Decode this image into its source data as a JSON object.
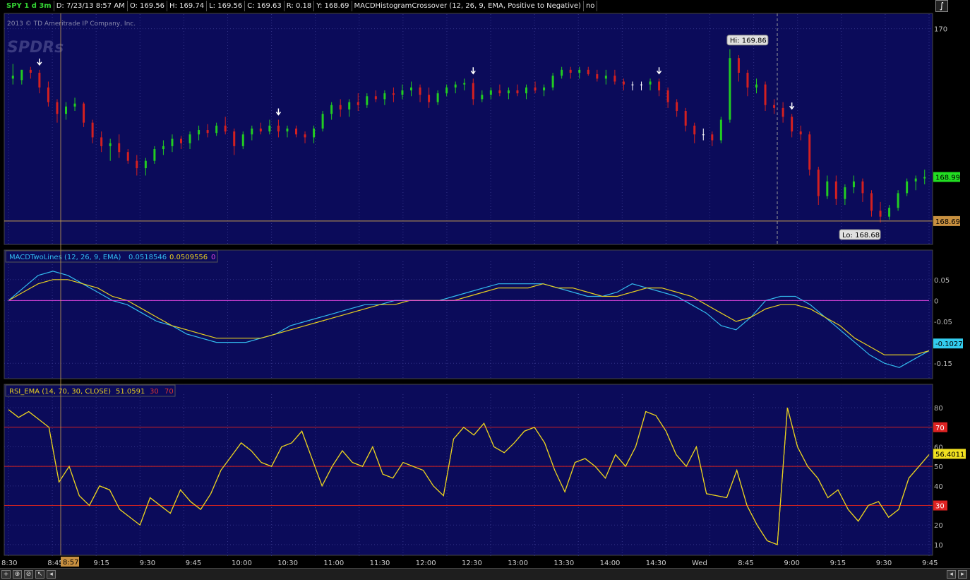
{
  "header": {
    "symbol": "SPY 1 d 3m",
    "date": "D: 7/23/13 8:57 AM",
    "open": "O: 169.56",
    "high": "H: 169.74",
    "low": "L: 169.56",
    "close": "C: 169.63",
    "range": "R: 0.18",
    "y": "Y: 168.69",
    "study": "MACDHistogramCrossover (12, 26, 9, EMA, Positive to Negative)",
    "study_value": "no"
  },
  "copyright": "2013 © TD Ameritrade IP Company, Inc.",
  "watermark": "SPDRs",
  "colors": {
    "background": "#0b0b5a",
    "up": "#22cc22",
    "down": "#d42020",
    "doji": "#ffffff",
    "macd": "#33bbee",
    "signal": "#e8d020",
    "zero": "#dd44dd",
    "rsi": "#e8d020",
    "rsi_lines": "#cc2222",
    "crosshair": "#c8a050"
  },
  "chart_data": [
    {
      "type": "candlestick",
      "title": "SPY 1 d 3m",
      "ylim": [
        168.55,
        170.08
      ],
      "y_ticks": [
        170
      ],
      "current_price": "168.99",
      "crosshair_price": "168.69",
      "hi_label": "Hi: 169.86",
      "lo_label": "Lo: 168.68",
      "sell_arrows_at_bar": [
        3,
        30,
        52,
        73,
        88
      ],
      "candles": [
        {
          "o": 169.66,
          "h": 169.76,
          "l": 169.62,
          "c": 169.68
        },
        {
          "o": 169.65,
          "h": 169.72,
          "l": 169.62,
          "c": 169.72
        },
        {
          "o": 169.72,
          "h": 169.74,
          "l": 169.66,
          "c": 169.7
        },
        {
          "o": 169.7,
          "h": 169.72,
          "l": 169.56,
          "c": 169.6
        },
        {
          "o": 169.6,
          "h": 169.64,
          "l": 169.47,
          "c": 169.5
        },
        {
          "o": 169.5,
          "h": 169.52,
          "l": 169.36,
          "c": 169.42
        },
        {
          "o": 169.42,
          "h": 169.5,
          "l": 169.38,
          "c": 169.47
        },
        {
          "o": 169.47,
          "h": 169.53,
          "l": 169.44,
          "c": 169.49
        },
        {
          "o": 169.49,
          "h": 169.5,
          "l": 169.33,
          "c": 169.36
        },
        {
          "o": 169.36,
          "h": 169.38,
          "l": 169.22,
          "c": 169.26
        },
        {
          "o": 169.26,
          "h": 169.3,
          "l": 169.16,
          "c": 169.2
        },
        {
          "o": 169.2,
          "h": 169.25,
          "l": 169.1,
          "c": 169.22
        },
        {
          "o": 169.22,
          "h": 169.28,
          "l": 169.12,
          "c": 169.16
        },
        {
          "o": 169.16,
          "h": 169.18,
          "l": 169.08,
          "c": 169.1
        },
        {
          "o": 169.1,
          "h": 169.14,
          "l": 169.0,
          "c": 169.05
        },
        {
          "o": 169.05,
          "h": 169.12,
          "l": 169.0,
          "c": 169.1
        },
        {
          "o": 169.1,
          "h": 169.2,
          "l": 169.08,
          "c": 169.18
        },
        {
          "o": 169.18,
          "h": 169.24,
          "l": 169.14,
          "c": 169.2
        },
        {
          "o": 169.2,
          "h": 169.28,
          "l": 169.16,
          "c": 169.25
        },
        {
          "o": 169.25,
          "h": 169.27,
          "l": 169.18,
          "c": 169.22
        },
        {
          "o": 169.22,
          "h": 169.3,
          "l": 169.18,
          "c": 169.28
        },
        {
          "o": 169.28,
          "h": 169.34,
          "l": 169.24,
          "c": 169.31
        },
        {
          "o": 169.31,
          "h": 169.35,
          "l": 169.26,
          "c": 169.29
        },
        {
          "o": 169.29,
          "h": 169.36,
          "l": 169.27,
          "c": 169.34
        },
        {
          "o": 169.34,
          "h": 169.4,
          "l": 169.28,
          "c": 169.3
        },
        {
          "o": 169.3,
          "h": 169.32,
          "l": 169.14,
          "c": 169.2
        },
        {
          "o": 169.2,
          "h": 169.3,
          "l": 169.18,
          "c": 169.28
        },
        {
          "o": 169.28,
          "h": 169.34,
          "l": 169.24,
          "c": 169.32
        },
        {
          "o": 169.32,
          "h": 169.36,
          "l": 169.28,
          "c": 169.3
        },
        {
          "o": 169.3,
          "h": 169.38,
          "l": 169.28,
          "c": 169.34
        },
        {
          "o": 169.34,
          "h": 169.38,
          "l": 169.26,
          "c": 169.3
        },
        {
          "o": 169.3,
          "h": 169.34,
          "l": 169.26,
          "c": 169.32
        },
        {
          "o": 169.32,
          "h": 169.34,
          "l": 169.26,
          "c": 169.28
        },
        {
          "o": 169.28,
          "h": 169.3,
          "l": 169.22,
          "c": 169.26
        },
        {
          "o": 169.26,
          "h": 169.34,
          "l": 169.22,
          "c": 169.32
        },
        {
          "o": 169.32,
          "h": 169.44,
          "l": 169.3,
          "c": 169.42
        },
        {
          "o": 169.42,
          "h": 169.5,
          "l": 169.38,
          "c": 169.48
        },
        {
          "o": 169.48,
          "h": 169.52,
          "l": 169.4,
          "c": 169.45
        },
        {
          "o": 169.45,
          "h": 169.52,
          "l": 169.4,
          "c": 169.5
        },
        {
          "o": 169.5,
          "h": 169.56,
          "l": 169.44,
          "c": 169.48
        },
        {
          "o": 169.48,
          "h": 169.56,
          "l": 169.46,
          "c": 169.54
        },
        {
          "o": 169.54,
          "h": 169.58,
          "l": 169.5,
          "c": 169.52
        },
        {
          "o": 169.52,
          "h": 169.58,
          "l": 169.48,
          "c": 169.56
        },
        {
          "o": 169.56,
          "h": 169.6,
          "l": 169.5,
          "c": 169.55
        },
        {
          "o": 169.55,
          "h": 169.62,
          "l": 169.52,
          "c": 169.58
        },
        {
          "o": 169.58,
          "h": 169.64,
          "l": 169.54,
          "c": 169.6
        },
        {
          "o": 169.6,
          "h": 169.62,
          "l": 169.5,
          "c": 169.55
        },
        {
          "o": 169.55,
          "h": 169.6,
          "l": 169.46,
          "c": 169.5
        },
        {
          "o": 169.5,
          "h": 169.58,
          "l": 169.48,
          "c": 169.56
        },
        {
          "o": 169.56,
          "h": 169.62,
          "l": 169.54,
          "c": 169.6
        },
        {
          "o": 169.6,
          "h": 169.64,
          "l": 169.56,
          "c": 169.62
        },
        {
          "o": 169.62,
          "h": 169.66,
          "l": 169.58,
          "c": 169.63
        },
        {
          "o": 169.63,
          "h": 169.66,
          "l": 169.48,
          "c": 169.52
        },
        {
          "o": 169.52,
          "h": 169.58,
          "l": 169.5,
          "c": 169.55
        },
        {
          "o": 169.55,
          "h": 169.6,
          "l": 169.52,
          "c": 169.58
        },
        {
          "o": 169.58,
          "h": 169.62,
          "l": 169.54,
          "c": 169.56
        },
        {
          "o": 169.56,
          "h": 169.6,
          "l": 169.52,
          "c": 169.58
        },
        {
          "o": 169.58,
          "h": 169.62,
          "l": 169.54,
          "c": 169.56
        },
        {
          "o": 169.56,
          "h": 169.62,
          "l": 169.52,
          "c": 169.6
        },
        {
          "o": 169.6,
          "h": 169.64,
          "l": 169.56,
          "c": 169.58
        },
        {
          "o": 169.58,
          "h": 169.62,
          "l": 169.54,
          "c": 169.6
        },
        {
          "o": 169.6,
          "h": 169.7,
          "l": 169.58,
          "c": 169.68
        },
        {
          "o": 169.68,
          "h": 169.74,
          "l": 169.66,
          "c": 169.72
        },
        {
          "o": 169.72,
          "h": 169.74,
          "l": 169.66,
          "c": 169.7
        },
        {
          "o": 169.7,
          "h": 169.74,
          "l": 169.66,
          "c": 169.72
        },
        {
          "o": 169.72,
          "h": 169.74,
          "l": 169.68,
          "c": 169.69
        },
        {
          "o": 169.69,
          "h": 169.72,
          "l": 169.64,
          "c": 169.66
        },
        {
          "o": 169.66,
          "h": 169.72,
          "l": 169.62,
          "c": 169.68
        },
        {
          "o": 169.68,
          "h": 169.72,
          "l": 169.62,
          "c": 169.64
        },
        {
          "o": 169.64,
          "h": 169.66,
          "l": 169.58,
          "c": 169.62
        },
        {
          "o": 169.62,
          "h": 169.64,
          "l": 169.58,
          "c": 169.62
        },
        {
          "o": 169.62,
          "h": 169.64,
          "l": 169.58,
          "c": 169.62
        },
        {
          "o": 169.62,
          "h": 169.66,
          "l": 169.58,
          "c": 169.64
        },
        {
          "o": 169.64,
          "h": 169.66,
          "l": 169.54,
          "c": 169.58
        },
        {
          "o": 169.58,
          "h": 169.6,
          "l": 169.46,
          "c": 169.5
        },
        {
          "o": 169.5,
          "h": 169.52,
          "l": 169.4,
          "c": 169.44
        },
        {
          "o": 169.44,
          "h": 169.46,
          "l": 169.3,
          "c": 169.34
        },
        {
          "o": 169.34,
          "h": 169.36,
          "l": 169.22,
          "c": 169.28
        },
        {
          "o": 169.28,
          "h": 169.32,
          "l": 169.24,
          "c": 169.28
        },
        {
          "o": 169.28,
          "h": 169.3,
          "l": 169.2,
          "c": 169.24
        },
        {
          "o": 169.24,
          "h": 169.4,
          "l": 169.22,
          "c": 169.38
        },
        {
          "o": 169.38,
          "h": 169.86,
          "l": 169.36,
          "c": 169.8
        },
        {
          "o": 169.8,
          "h": 169.82,
          "l": 169.64,
          "c": 169.7
        },
        {
          "o": 169.7,
          "h": 169.72,
          "l": 169.54,
          "c": 169.6
        },
        {
          "o": 169.6,
          "h": 169.66,
          "l": 169.56,
          "c": 169.62
        },
        {
          "o": 169.62,
          "h": 169.64,
          "l": 169.44,
          "c": 169.48
        },
        {
          "o": 169.48,
          "h": 169.52,
          "l": 169.42,
          "c": 169.46
        },
        {
          "o": 169.46,
          "h": 169.5,
          "l": 169.36,
          "c": 169.4
        },
        {
          "o": 169.4,
          "h": 169.42,
          "l": 169.26,
          "c": 169.3
        },
        {
          "o": 169.3,
          "h": 169.34,
          "l": 169.24,
          "c": 169.28
        },
        {
          "o": 169.28,
          "h": 169.3,
          "l": 169.0,
          "c": 169.04
        },
        {
          "o": 169.04,
          "h": 169.06,
          "l": 168.8,
          "c": 168.86
        },
        {
          "o": 168.86,
          "h": 169.0,
          "l": 168.84,
          "c": 168.96
        },
        {
          "o": 168.96,
          "h": 169.0,
          "l": 168.8,
          "c": 168.84
        },
        {
          "o": 168.84,
          "h": 168.94,
          "l": 168.8,
          "c": 168.92
        },
        {
          "o": 168.92,
          "h": 169.0,
          "l": 168.88,
          "c": 168.96
        },
        {
          "o": 168.96,
          "h": 168.98,
          "l": 168.82,
          "c": 168.88
        },
        {
          "o": 168.88,
          "h": 168.9,
          "l": 168.72,
          "c": 168.76
        },
        {
          "o": 168.76,
          "h": 168.82,
          "l": 168.68,
          "c": 168.72
        },
        {
          "o": 168.72,
          "h": 168.8,
          "l": 168.7,
          "c": 168.78
        },
        {
          "o": 168.78,
          "h": 168.9,
          "l": 168.76,
          "c": 168.88
        },
        {
          "o": 168.88,
          "h": 168.98,
          "l": 168.86,
          "c": 168.96
        },
        {
          "o": 168.96,
          "h": 169.0,
          "l": 168.9,
          "c": 168.98
        },
        {
          "o": 168.98,
          "h": 169.04,
          "l": 168.94,
          "c": 168.99
        }
      ]
    },
    {
      "type": "line",
      "title": "MACDTwoLines (12, 26, 9, EMA)",
      "value_labels": [
        "0.0518546",
        "0.0509556",
        "0"
      ],
      "ylim": [
        -0.18,
        0.08
      ],
      "y_ticks": [
        0.05,
        0,
        -0.05,
        -0.15
      ],
      "y_tick_labels": [
        "0.05",
        "0",
        "-0.05",
        "-0.15"
      ],
      "current_label": "-0.1027",
      "series": [
        {
          "values": [
            0.0,
            0.03,
            0.06,
            0.07,
            0.06,
            0.04,
            0.02,
            0.0,
            -0.01,
            -0.03,
            -0.05,
            -0.06,
            -0.08,
            -0.09,
            -0.1,
            -0.1,
            -0.1,
            -0.09,
            -0.08,
            -0.06,
            -0.05,
            -0.04,
            -0.03,
            -0.02,
            -0.01,
            -0.01,
            0.0,
            0.0,
            0.0,
            0.0,
            0.01,
            0.02,
            0.03,
            0.04,
            0.04,
            0.04,
            0.04,
            0.03,
            0.02,
            0.01,
            0.01,
            0.02,
            0.04,
            0.03,
            0.02,
            0.01,
            -0.01,
            -0.03,
            -0.06,
            -0.07,
            -0.04,
            0.0,
            0.01,
            0.01,
            -0.01,
            -0.04,
            -0.07,
            -0.1,
            -0.13,
            -0.15,
            -0.16,
            -0.14,
            -0.12
          ]
        },
        {
          "values": [
            0.0,
            0.02,
            0.04,
            0.05,
            0.05,
            0.04,
            0.03,
            0.01,
            0.0,
            -0.02,
            -0.04,
            -0.06,
            -0.07,
            -0.08,
            -0.09,
            -0.09,
            -0.09,
            -0.09,
            -0.08,
            -0.07,
            -0.06,
            -0.05,
            -0.04,
            -0.03,
            -0.02,
            -0.01,
            -0.01,
            0.0,
            0.0,
            0.0,
            0.0,
            0.01,
            0.02,
            0.03,
            0.03,
            0.03,
            0.04,
            0.03,
            0.03,
            0.02,
            0.01,
            0.01,
            0.02,
            0.03,
            0.03,
            0.02,
            0.01,
            -0.01,
            -0.03,
            -0.05,
            -0.04,
            -0.02,
            -0.01,
            -0.01,
            -0.02,
            -0.04,
            -0.06,
            -0.09,
            -0.11,
            -0.13,
            -0.13,
            -0.13,
            -0.12
          ]
        },
        {
          "values": [
            0,
            0
          ]
        }
      ]
    },
    {
      "type": "line",
      "title": "RSI_EMA (14, 70, 30, CLOSE)",
      "value_labels": [
        "51.0591",
        "30",
        "70"
      ],
      "ylim": [
        6,
        84
      ],
      "y_ticks": [
        80,
        60,
        50,
        40,
        20,
        10
      ],
      "y_tick_labels": [
        "80",
        "60",
        "50",
        "40",
        "20",
        "10"
      ],
      "levels": [
        70,
        50,
        30
      ],
      "level_labels": [
        "70",
        "30"
      ],
      "current_label": "56.4011",
      "series": [
        {
          "values": [
            79,
            75,
            78,
            74,
            70,
            42,
            50,
            35,
            30,
            40,
            38,
            28,
            24,
            20,
            34,
            30,
            26,
            38,
            32,
            28,
            36,
            48,
            55,
            62,
            58,
            52,
            50,
            60,
            62,
            68,
            54,
            40,
            50,
            58,
            52,
            50,
            60,
            46,
            44,
            52,
            50,
            48,
            40,
            35,
            64,
            70,
            66,
            72,
            60,
            57,
            62,
            68,
            70,
            62,
            48,
            37,
            52,
            54,
            50,
            44,
            56,
            50,
            60,
            78,
            76,
            68,
            56,
            50,
            60,
            36,
            35,
            34,
            48,
            30,
            20,
            12,
            10,
            80,
            60,
            50,
            44,
            34,
            38,
            28,
            22,
            30,
            32,
            24,
            28,
            44,
            50,
            56
          ]
        }
      ]
    }
  ],
  "x_axis": {
    "labels": [
      "8:30",
      "8:45",
      "9:15",
      "9:30",
      "9:45",
      "10:00",
      "10:30",
      "11:00",
      "11:30",
      "12:00",
      "12:30",
      "13:00",
      "13:30",
      "14:00",
      "14:30",
      "Wed",
      "8:45",
      "9:00",
      "9:15",
      "9:30",
      "9:45"
    ],
    "cursor_label": "8:57"
  },
  "bottom_bar": {
    "buttons": [
      "+",
      "⊕",
      "⊘",
      "↖",
      "◂"
    ],
    "right_buttons": [
      "◂",
      "▸"
    ]
  }
}
